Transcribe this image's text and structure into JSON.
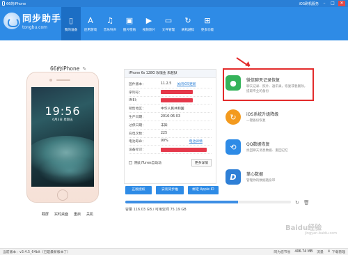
{
  "titlebar": {
    "device": "66的iPhone",
    "service": "iOS刷机服务",
    "controls": {
      "min": "–",
      "max": "□",
      "close": "✕"
    }
  },
  "brand": {
    "name": "同步助手",
    "url": "tongbu.com"
  },
  "nav": [
    {
      "label": "我的设备",
      "icon": "phone-icon",
      "glyph": "▯",
      "active": true
    },
    {
      "label": "应用游戏",
      "icon": "appstore-icon",
      "glyph": "A"
    },
    {
      "label": "音乐铃声",
      "icon": "music-icon",
      "glyph": "♫"
    },
    {
      "label": "图片壁纸",
      "icon": "image-icon",
      "glyph": "▣"
    },
    {
      "label": "视频影片",
      "icon": "video-icon",
      "glyph": "▶"
    },
    {
      "label": "文件管理",
      "icon": "folder-icon",
      "glyph": "▭"
    },
    {
      "label": "刷机越狱",
      "icon": "refresh-icon",
      "glyph": "↻"
    },
    {
      "label": "更多功能",
      "icon": "grid-icon",
      "glyph": "⊞"
    }
  ],
  "device": {
    "name": "66的iPhone",
    "time": "19:56",
    "date": "6月3日 星期五",
    "actions": [
      "截屏",
      "实时桌面",
      "重启",
      "关机"
    ]
  },
  "info": {
    "header": "iPhone 6s 128G 玫瑰金 未越狱",
    "rows": [
      {
        "key": "固件版本：",
        "value": "11.2.5",
        "link": "关闭iOS更新"
      },
      {
        "key": "序列号：",
        "value": "",
        "redacted": true
      },
      {
        "key": "IMEI：",
        "value": "",
        "redacted": true
      },
      {
        "key": "销售地区：",
        "value": "中华人民共和国"
      },
      {
        "key": "生产日期：",
        "value": "2016-06-03"
      },
      {
        "key": "过保日期：",
        "value": "未知"
      },
      {
        "key": "充电次数：",
        "value": "225"
      },
      {
        "key": "电池寿命：",
        "value": "90%",
        "link": "电池详情"
      },
      {
        "key": "设备标识：",
        "value": "",
        "redacted": true
      }
    ],
    "sync_label": "随此iTunes自动动",
    "more_label": "更多详情"
  },
  "actions": {
    "trust": "正版授权",
    "backup": "安装同步推",
    "appleid": "绑定 Apple ID"
  },
  "storage": {
    "label": "容量",
    "used": "116.03 GB / 可用空间",
    "free": "75.19 GB",
    "used_fraction": 0.68
  },
  "tools": [
    {
      "title": "微信聊天记录恢复",
      "desc": "聊天记录、照片、通讯录，恢复或者删除，提取专业的备份",
      "color": "#35b35a",
      "icon": "wechat-icon",
      "glyph": "●"
    },
    {
      "title": "iOS系统升级降级",
      "desc": "一键备份恢复",
      "color": "#f39a1e",
      "icon": "update-icon",
      "glyph": "↻"
    },
    {
      "title": "QQ数据恢复",
      "desc": "找回聊天消息数据、重回记忆",
      "color": "#2e8be6",
      "icon": "recover-icon",
      "glyph": "⟲"
    },
    {
      "title": "掌心数据",
      "desc": "管理你的数据随身带",
      "color": "#2e7fd6",
      "icon": "brand-d-icon",
      "glyph": "D"
    }
  ],
  "status": {
    "version": "当前版本：v3.4.5_64bit（已是最新版本了）",
    "sync_label": "同为您节省",
    "sync_value": "406.74 MB",
    "flow_label": "流量",
    "download": "下载管理"
  },
  "watermark": {
    "text": "Baidu经验",
    "sub": "jingyan.baidu.com"
  }
}
